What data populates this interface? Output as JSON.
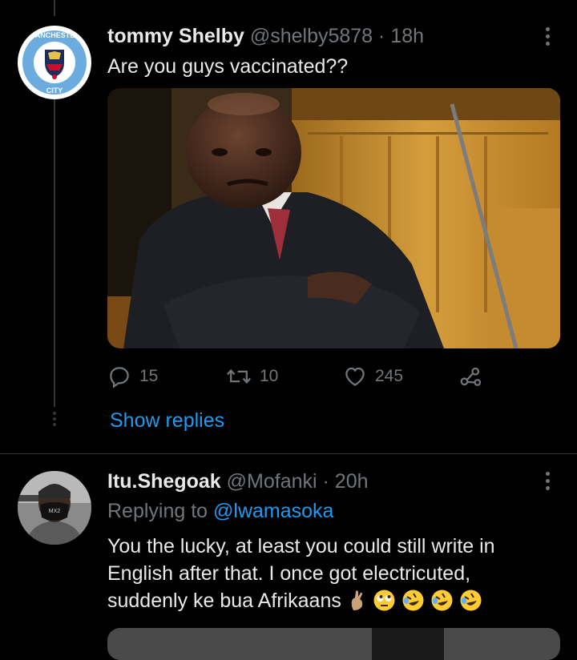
{
  "tweet1": {
    "display_name": "tommy Shelby",
    "handle": "@shelby5878",
    "separator": "·",
    "time": "18h",
    "text": "Are you guys vaccinated??",
    "avatar_badge": {
      "top": "MANCHESTER",
      "bottom": "CITY",
      "colors": [
        "#6cabdd",
        "#1c2c5b",
        "#ffffff"
      ]
    },
    "actions": {
      "replies": "15",
      "retweets": "10",
      "likes": "245"
    },
    "show_replies": "Show replies"
  },
  "tweet2": {
    "display_name": "Itu.Shegoak",
    "handle": "@Mofanki",
    "separator": "·",
    "time": "20h",
    "replying_prefix": "Replying to",
    "replying_handle": "@lwamasoka",
    "text_lines": [
      "You the lucky, at least you could still write in",
      "English after that. I once got electricuted,",
      "suddenly ke bua Afrikaans"
    ],
    "emojis": [
      "crossed-fingers",
      "rolling-eyes",
      "rofl",
      "rofl",
      "rofl"
    ]
  },
  "colors": {
    "background": "#000000",
    "text": "#e7e9ea",
    "secondary": "#71767b",
    "link": "#1d9bf0",
    "divider": "#2f3336"
  }
}
